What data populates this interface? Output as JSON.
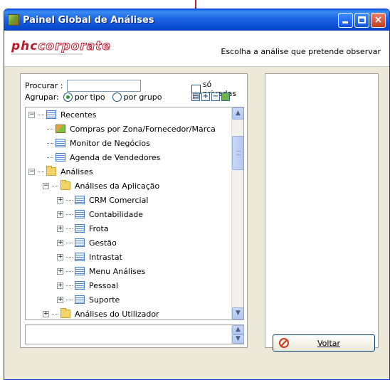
{
  "window": {
    "title": "Painel Global de Análises"
  },
  "header": {
    "logo": {
      "part1": "phc",
      "part2": "corporate"
    },
    "instruction": "Escolha a análise que pretende observar"
  },
  "filters": {
    "search_label": "Procurar :",
    "search_value": "",
    "private_label": "só privadas",
    "group_label": "Agrupar:",
    "radio_type": "por tipo",
    "radio_group": "por grupo",
    "selected_grouping": "por tipo"
  },
  "tree": {
    "recent": {
      "label": "Recentes",
      "items": [
        "Compras por Zona/Fornecedor/Marca",
        "Monitor de Negócios",
        "Agenda de Vendedores"
      ]
    },
    "analyses": {
      "label": "Análises",
      "app": {
        "label": "Análises da Aplicação",
        "items": [
          "CRM Comercial",
          "Contabilidade",
          "Frota",
          "Gestão",
          "Intrastat",
          "Menu Análises",
          "Pessoal",
          "Suporte"
        ]
      },
      "user": {
        "label": "Análises do Utilizador"
      }
    }
  },
  "actions": {
    "back_label": "Voltar"
  },
  "colors": {
    "titlebar": "#0a5ddc",
    "brand": "#c0182a"
  }
}
